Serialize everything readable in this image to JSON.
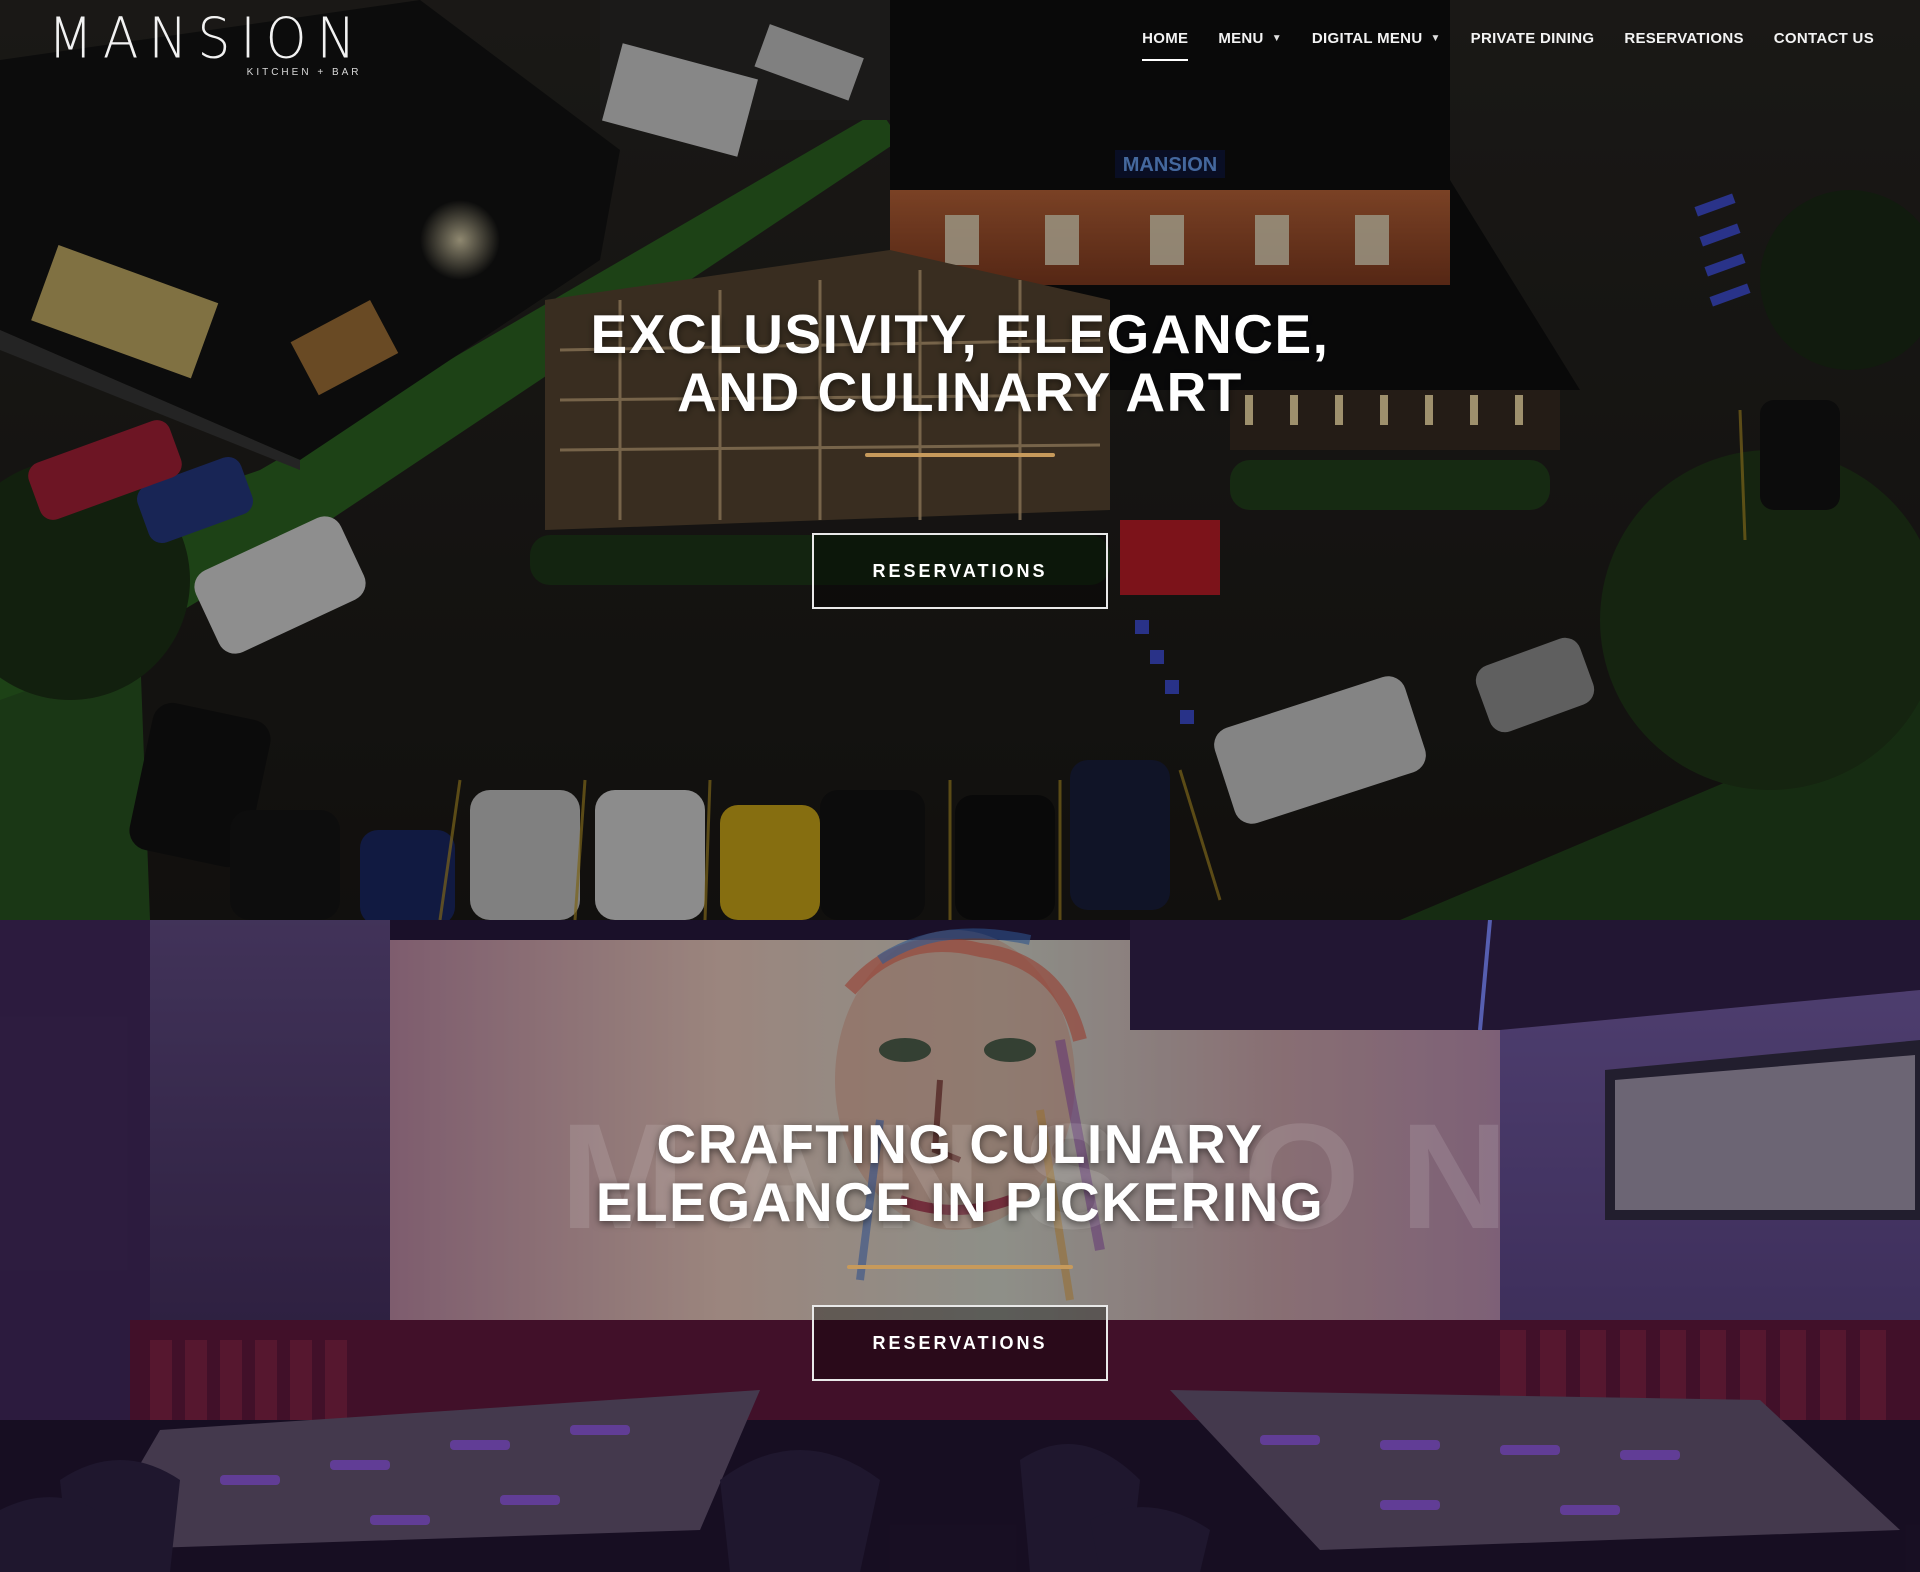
{
  "brand": {
    "name": "MANSION",
    "tagline": "KITCHEN + BAR"
  },
  "nav": {
    "items": [
      {
        "label": "HOME",
        "active": true,
        "has_dropdown": false
      },
      {
        "label": "MENU",
        "active": false,
        "has_dropdown": true
      },
      {
        "label": "DIGITAL MENU",
        "active": false,
        "has_dropdown": true
      },
      {
        "label": "PRIVATE DINING",
        "active": false,
        "has_dropdown": false
      },
      {
        "label": "RESERVATIONS",
        "active": false,
        "has_dropdown": false
      },
      {
        "label": "CONTACT US",
        "active": false,
        "has_dropdown": false
      }
    ]
  },
  "hero_1": {
    "title": "EXCLUSIVITY, ELEGANCE,\nAND CULINARY ART",
    "button_label": "RESERVATIONS",
    "building_sign": "MANSION"
  },
  "hero_2": {
    "title": "CRAFTING CULINARY\nELEGANCE IN PICKERING",
    "button_label": "RESERVATIONS",
    "wall_watermark": "MANSION"
  },
  "colors": {
    "accent_rule": "#c79a5b",
    "neon_blue": "#4a5dff",
    "banquette_red": "#7a1f3a"
  }
}
